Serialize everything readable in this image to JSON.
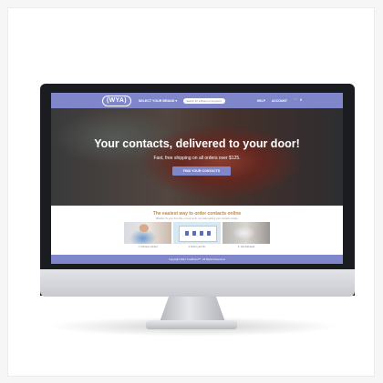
{
  "nav": {
    "logo": "(WYA)",
    "brand_select": "SELECT YOUR BRAND ▾",
    "search_placeholder": "Search for a Brand or Keyword",
    "help": "HELP",
    "account": "ACCOUNT",
    "cart_icon": "cart-icon",
    "cart_count": "0"
  },
  "hero": {
    "title": "Your contacts, delivered to your door!",
    "subtitle": "Fast, free shipping on all orders over $125.",
    "cta": "FIND YOUR CONTACTS"
  },
  "section": {
    "title": "The easiest way to order contacts online",
    "subtitle": "Whether it's your first time or your tenth, we make getting your contacts simple."
  },
  "features": [
    {
      "caption": "1. Choose a brand"
    },
    {
      "caption": "2. Enter your Rx"
    },
    {
      "caption": "3. Get delivered"
    }
  ],
  "footer": {
    "text": "Copyright 2021 YourBrand™. All Rights Reserved."
  },
  "colors": {
    "accent": "#7f86c9",
    "highlight": "#c9892c",
    "bezel": "#1b1c20"
  }
}
